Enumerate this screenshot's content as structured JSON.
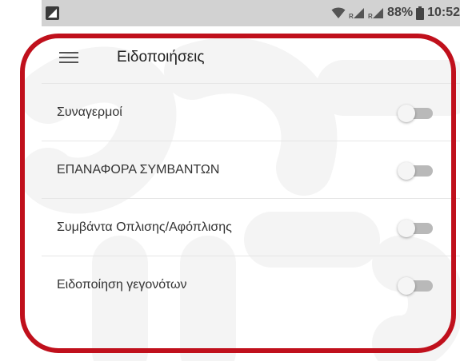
{
  "status_bar": {
    "battery_percent": "88%",
    "time": "10:52",
    "left_icon": "image-icon",
    "right_icons": [
      "wifi-icon",
      "signal-icon",
      "signal-icon",
      "battery-icon"
    ]
  },
  "app_bar": {
    "title": "Ειδοποιήσεις",
    "menu_icon": "hamburger-menu-icon"
  },
  "settings": [
    {
      "label": "Συναγερμοί",
      "enabled": false
    },
    {
      "label": "ΕΠΑΝΑΦΟΡΑ ΣΥΜΒΑΝΤΩΝ",
      "enabled": false
    },
    {
      "label": "Συμβάντα Οπλισης/Αφόπλισης",
      "enabled": false
    },
    {
      "label": "Ειδοποίηση γεγονότων",
      "enabled": false
    }
  ],
  "colors": {
    "frame": "#c0101c",
    "status_bar_bg": "#d2d2d2",
    "toggle_track_off": "#b9b9b9",
    "toggle_thumb_off": "#f5f5f5"
  }
}
